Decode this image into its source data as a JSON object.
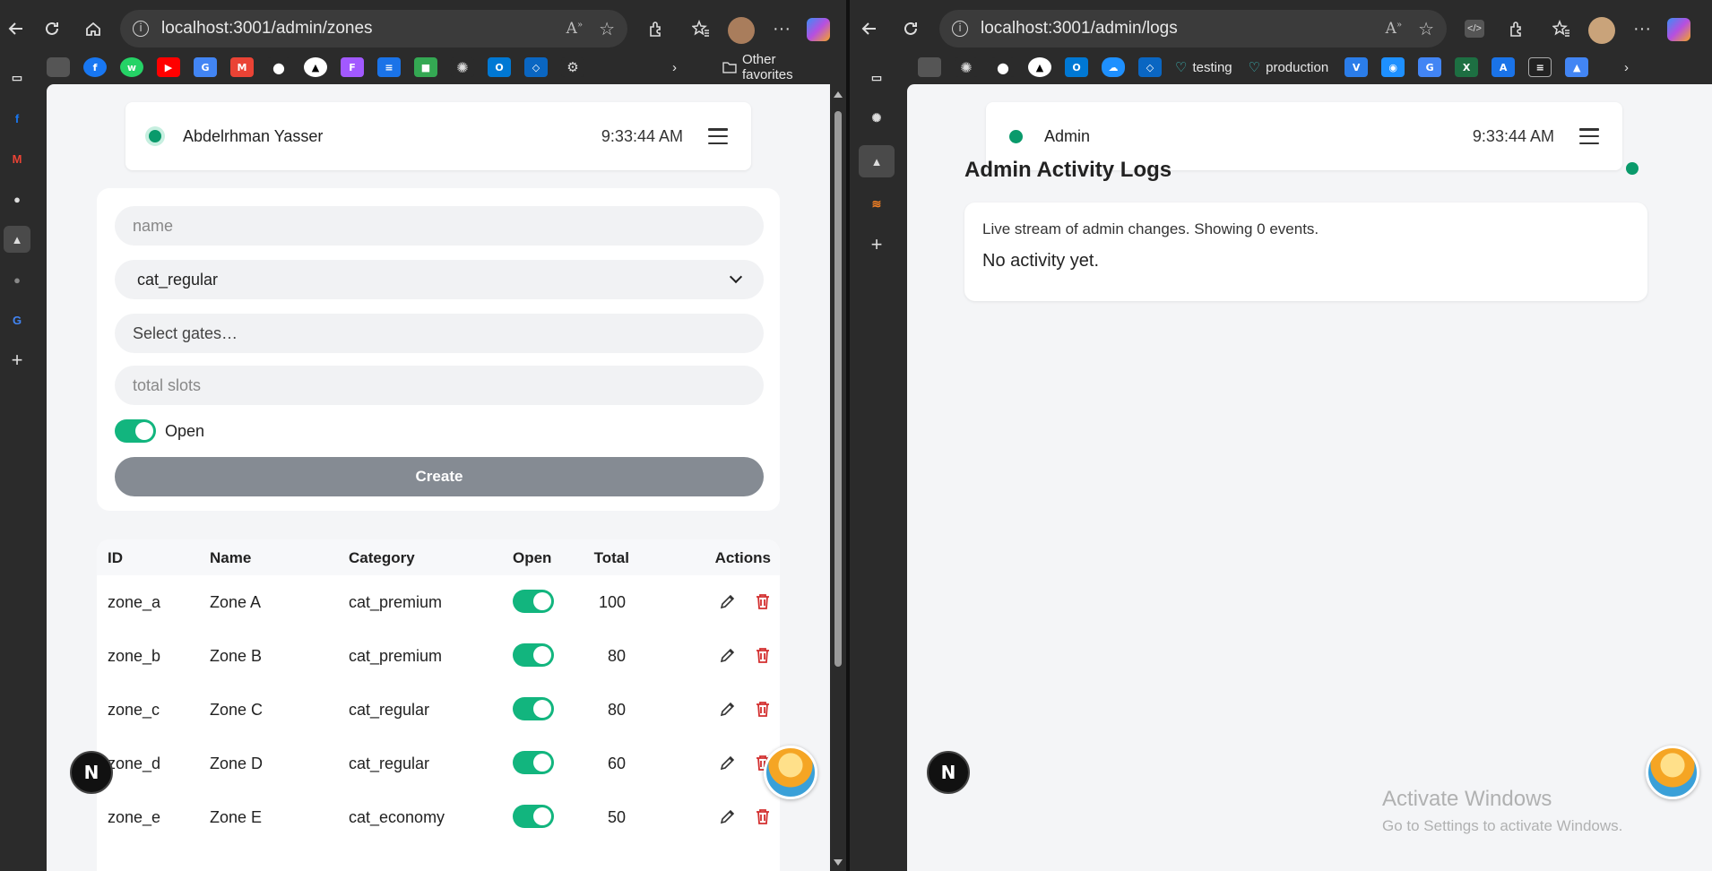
{
  "left_browser": {
    "url": "localhost:3001/admin/zones",
    "other_favorites": "Other favorites",
    "header": {
      "user_name": "Abdelrhman Yasser",
      "time": "9:33:44 AM"
    },
    "form": {
      "name_placeholder": "name",
      "category_selected": "cat_regular",
      "gates_placeholder": "Select gates…",
      "total_placeholder": "total slots",
      "open_label": "Open",
      "create_label": "Create"
    },
    "table": {
      "headers": {
        "id": "ID",
        "name": "Name",
        "category": "Category",
        "total": "Total",
        "open": "Open",
        "actions": "Actions"
      },
      "rows": [
        {
          "id": "zone_a",
          "name": "Zone A",
          "category": "cat_premium",
          "total": "100",
          "open": true
        },
        {
          "id": "zone_b",
          "name": "Zone B",
          "category": "cat_premium",
          "total": "80",
          "open": true
        },
        {
          "id": "zone_c",
          "name": "Zone C",
          "category": "cat_regular",
          "total": "80",
          "open": true
        },
        {
          "id": "zone_d",
          "name": "Zone D",
          "category": "cat_regular",
          "total": "60",
          "open": true
        },
        {
          "id": "zone_e",
          "name": "Zone E",
          "category": "cat_economy",
          "total": "50",
          "open": true
        }
      ]
    },
    "next_badge": "N"
  },
  "right_browser": {
    "url": "localhost:3001/admin/logs",
    "fav_testing": "testing",
    "fav_production": "production",
    "header": {
      "user_name": "Admin",
      "time": "9:33:44 AM"
    },
    "logs": {
      "title": "Admin Activity Logs",
      "subtitle": "Live stream of admin changes. Showing 0 events.",
      "empty": "No activity yet."
    },
    "next_badge": "N"
  },
  "watermark": {
    "line1": "Activate Windows",
    "line2": "Go to Settings to activate Windows."
  },
  "colors": {
    "accent_green": "#12b57e",
    "status_green": "#0a9a6b",
    "danger_red": "#d32f2f",
    "create_button": "#858b93"
  }
}
